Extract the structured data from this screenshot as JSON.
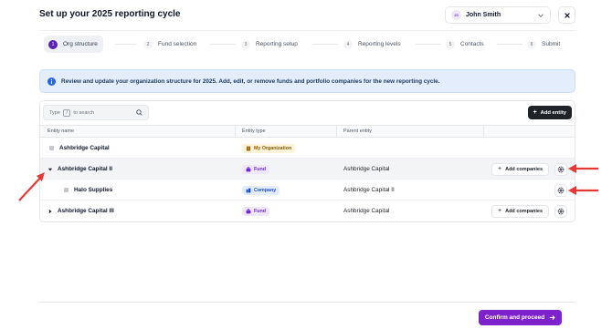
{
  "header": {
    "title": "Set up your 2025 reporting cycle",
    "user": {
      "initials": "JS",
      "name": "John Smith"
    }
  },
  "stepper": [
    {
      "num": "1",
      "label": "Org structure",
      "active": true
    },
    {
      "num": "2",
      "label": "Fund selection",
      "active": false
    },
    {
      "num": "3",
      "label": "Reporting setup",
      "active": false
    },
    {
      "num": "4",
      "label": "Reporting levels",
      "active": false
    },
    {
      "num": "5",
      "label": "Contacts",
      "active": false
    },
    {
      "num": "6",
      "label": "Submit",
      "active": false
    }
  ],
  "banner": {
    "text": "Review and update your organization structure for 2025. Add, edit, or remove funds and portfolio companies for the new reporting cycle."
  },
  "toolbar": {
    "search_prefix": "Type",
    "search_key": "/",
    "search_suffix": "to search",
    "add_entity": "Add entity"
  },
  "table": {
    "columns": [
      "Entity name",
      "Entity type",
      "Parent entity"
    ],
    "rows": [
      {
        "name": "Ashbridge Capital",
        "type": "My Organization",
        "parent": "",
        "add_companies": ""
      },
      {
        "name": "Ashbridge Capital II",
        "type": "Fund",
        "parent": "Ashbridge Capital",
        "add_companies": "Add companies"
      },
      {
        "name": "Halo Supplies",
        "type": "Company",
        "parent": "Ashbridge Capital II",
        "add_companies": ""
      },
      {
        "name": "Ashbridge Capital III",
        "type": "Fund",
        "parent": "Ashbridge Capital",
        "add_companies": "Add companies"
      }
    ]
  },
  "footer": {
    "confirm": "Confirm and proceed"
  },
  "colors": {
    "accent": "#7e22ce",
    "annotation_arrow": "#e53935",
    "banner_bg": "#e3edfb"
  }
}
